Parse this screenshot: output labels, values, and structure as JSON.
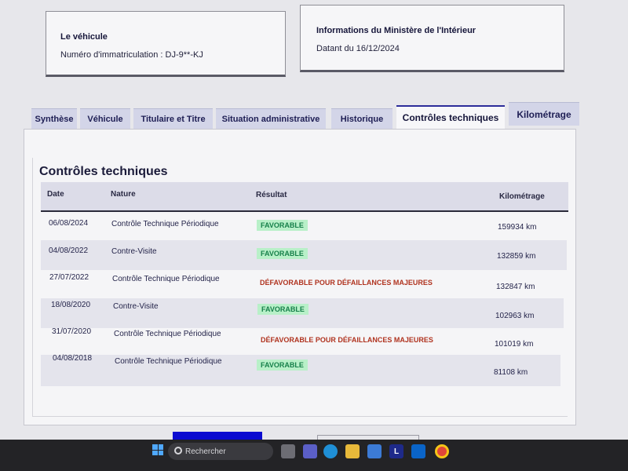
{
  "vehicle_card": {
    "title": "Le véhicule",
    "plate_label": "Numéro d'immatriculation : DJ-9**-KJ"
  },
  "ministry_card": {
    "title": "Informations du Ministère de l'Intérieur",
    "date_line": "Datant du 16/12/2024"
  },
  "tabs": [
    {
      "label": "Synthèse"
    },
    {
      "label": "Véhicule"
    },
    {
      "label": "Titulaire et Titre"
    },
    {
      "label": "Situation administrative"
    },
    {
      "label": "Historique"
    },
    {
      "label": "Contrôles techniques",
      "active": true
    },
    {
      "label": "Kilométrage"
    }
  ],
  "section": {
    "title": "Contrôles techniques",
    "columns": [
      "Date",
      "Nature",
      "Résultat",
      "Kilométrage"
    ],
    "rows": [
      {
        "date": "06/08/2024",
        "nature": "Contrôle Technique Périodique",
        "result": "FAVORABLE",
        "km": "159934 km"
      },
      {
        "date": "04/08/2022",
        "nature": "Contre-Visite",
        "result": "FAVORABLE",
        "km": "132859 km"
      },
      {
        "date": "27/07/2022",
        "nature": "Contrôle Technique Périodique",
        "result": "DÉFAVORABLE POUR DÉFAILLANCES MAJEURES",
        "km": "132847 km"
      },
      {
        "date": "18/08/2020",
        "nature": "Contre-Visite",
        "result": "FAVORABLE",
        "km": "102963 km"
      },
      {
        "date": "31/07/2020",
        "nature": "Contrôle Technique Périodique",
        "result": "DÉFAVORABLE POUR DÉFAILLANCES MAJEURES",
        "km": "101019 km"
      },
      {
        "date": "04/08/2018",
        "nature": "Contrôle Technique Périodique",
        "result": "FAVORABLE",
        "km": "81108 km"
      }
    ]
  },
  "taskbar": {
    "search_placeholder": "Rechercher",
    "app_letter": "L"
  },
  "colors": {
    "favorable_bg": "#b8f0c8",
    "favorable_text": "#16804a",
    "defavorable_text": "#b0331f",
    "active_tab_border": "#2d2d9a"
  }
}
